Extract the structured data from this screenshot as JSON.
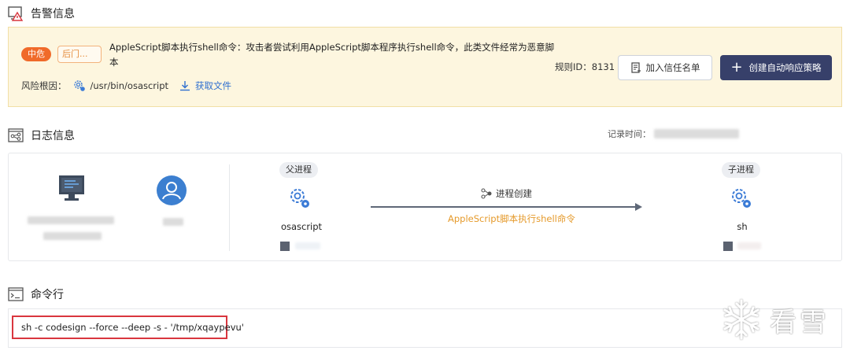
{
  "alert_section": {
    "title": "告警信息",
    "severity_tag": "中危",
    "category_tag": "后门...",
    "description": "AppleScript脚本执行shell命令：攻击者尝试利用AppleScript脚本程序执行shell命令，此类文件经常为恶意脚本",
    "risk_root_label": "风险根因：",
    "risk_root_path": "/usr/bin/osascript",
    "get_file_label": "获取文件",
    "rule_id_text": "规则ID：8131",
    "trust_button_label": "加入信任名单",
    "auto_response_button_label": "创建自动响应策略"
  },
  "log_section": {
    "title": "日志信息",
    "record_time_label": "记录时间："
  },
  "process_graph": {
    "parent_label": "父进程",
    "child_label": "子进程",
    "parent_name": "osascript",
    "child_name": "sh",
    "edge_label": "进程创建",
    "edge_sublabel": "AppleScript脚本执行shell命令"
  },
  "command_section": {
    "title": "命令行",
    "command": "sh -c codesign --force --deep -s - '/tmp/xqaypevu'"
  },
  "watermark": {
    "text": "看雪"
  },
  "colors": {
    "alert_bg": "#fdf6df",
    "severity_orange": "#f06a2a",
    "primary_button": "#37406a",
    "link_blue": "#2f6fcf",
    "edge_label_orange": "#e59a2b",
    "highlight_red": "#d9363e"
  }
}
